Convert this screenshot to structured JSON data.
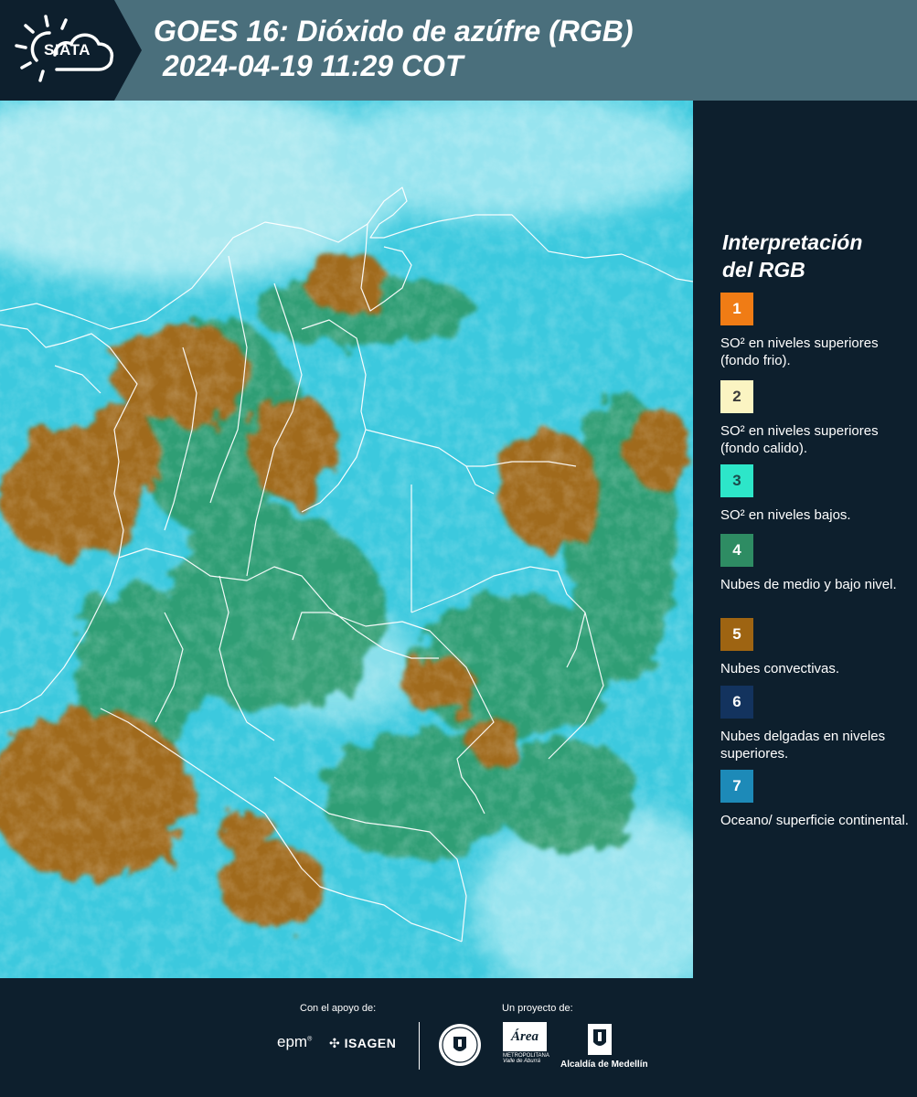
{
  "header": {
    "logo_text": "SIATA",
    "title": "GOES 16: Dióxido de azúfre (RGB)",
    "timestamp": "2024-04-19 11:29 COT"
  },
  "map": {
    "icon": "satellite-map",
    "background_color": "#3cc9de"
  },
  "legend": {
    "title_line1": "Interpretación",
    "title_line2": "del RGB",
    "items": [
      {
        "number": "1",
        "color": "#f07c15",
        "text_color": "#ffffff",
        "label": "SO² en niveles superiores (fondo frio)."
      },
      {
        "number": "2",
        "color": "#fbf4c2",
        "text_color": "#3a3a3a",
        "label": "SO² en niveles superiores (fondo calido)."
      },
      {
        "number": "3",
        "color": "#2de6c9",
        "text_color": "#1a4a4a",
        "label": "SO² en niveles bajos."
      },
      {
        "number": "4",
        "color": "#2e8c63",
        "text_color": "#ffffff",
        "label": "Nubes de medio y bajo nivel."
      },
      {
        "number": "5",
        "color": "#9e6412",
        "text_color": "#ffffff",
        "label": "Nubes convectivas."
      },
      {
        "number": "6",
        "color": "#13335e",
        "text_color": "#ffffff",
        "label": "Nubes delgadas en niveles superiores."
      },
      {
        "number": "7",
        "color": "#1d8ab8",
        "text_color": "#ffffff",
        "label": "Oceano/ superficie continental."
      }
    ]
  },
  "footer": {
    "support_label": "Con el apoyo de:",
    "project_label": "Un proyecto de:",
    "epm": "epm",
    "isagen": "ISAGEN",
    "area_line1": "Área",
    "area_line2": "METROPOLITANA",
    "area_line3": "Valle de Aburrá",
    "alcaldia": "Alcaldía de Medellín"
  }
}
